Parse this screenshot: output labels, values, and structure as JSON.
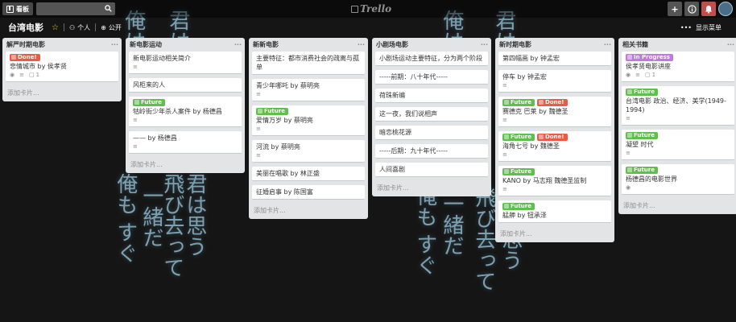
{
  "topbar": {
    "boards_label": "看板",
    "search_value": "",
    "logo_text": "Trello",
    "add_icon": "plus-icon",
    "info_icon": "info-icon",
    "notif_icon": "bell-icon"
  },
  "board": {
    "title": "台湾电影",
    "visibility_team": "个人",
    "visibility_public": "公开",
    "show_menu": "显示菜单"
  },
  "colors": {
    "red": "#eb5a46",
    "green": "#61bd4f",
    "purple": "#c377e0"
  },
  "lists": [
    {
      "name": "解严时期电影",
      "cards": [
        {
          "title": "悲情城市 by 侯孝贤",
          "labels": [
            {
              "text": "Done!",
              "color": "red"
            }
          ],
          "badges": {
            "watch": true,
            "desc": true,
            "checklist": "1"
          }
        }
      ],
      "add": "添加卡片..."
    },
    {
      "name": "新电影运动",
      "cards": [
        {
          "title": "新电影运动相关简介",
          "labels": [],
          "badges": {
            "desc": true
          }
        },
        {
          "title": "风柜来的人",
          "labels": [],
          "badges": {}
        },
        {
          "title": "牯岭街少年杀人案件 by 杨德昌",
          "labels": [
            {
              "text": "Future",
              "color": "green"
            }
          ],
          "badges": {
            "desc": true
          }
        },
        {
          "title": "—— by 杨德昌",
          "labels": [],
          "badges": {
            "desc": true
          }
        }
      ],
      "add": "添加卡片..."
    },
    {
      "name": "新新电影",
      "cards": [
        {
          "title": "主要特征：都市消费社会的疏离与孤单",
          "labels": [],
          "badges": {}
        },
        {
          "title": "青少年哪吒 by 蔡明亮",
          "labels": [],
          "badges": {
            "desc": true
          }
        },
        {
          "title": "爱情万岁 by 蔡明亮",
          "labels": [
            {
              "text": "Future",
              "color": "green"
            }
          ],
          "badges": {
            "desc": true
          }
        },
        {
          "title": "河流 by 蔡明亮",
          "labels": [],
          "badges": {
            "desc": true
          }
        },
        {
          "title": "美丽在唱歌 by 林正盛",
          "labels": [],
          "badges": {}
        },
        {
          "title": "征婚启事 by 陈国富",
          "labels": [],
          "badges": {}
        }
      ],
      "add": "添加卡片..."
    },
    {
      "name": "小剧场电影",
      "cards": [
        {
          "title": "小剧场运动主要特征，分为两个阶段",
          "labels": [],
          "badges": {}
        },
        {
          "title": "-----前期：八十年代-----",
          "labels": [],
          "badges": {}
        },
        {
          "title": "荷珠新编",
          "labels": [],
          "badges": {}
        },
        {
          "title": "这一夜，我们说相声",
          "labels": [],
          "badges": {}
        },
        {
          "title": "暗恋桃花源",
          "labels": [],
          "badges": {}
        },
        {
          "title": "-----后期：九十年代-----",
          "labels": [],
          "badges": {}
        },
        {
          "title": "人间喜剧",
          "labels": [],
          "badges": {}
        }
      ],
      "add": "添加卡片..."
    },
    {
      "name": "新时期电影",
      "cards": [
        {
          "title": "第四幅画 by 钟孟宏",
          "labels": [],
          "badges": {}
        },
        {
          "title": "停车 by 钟孟宏",
          "labels": [],
          "badges": {
            "desc": true
          }
        },
        {
          "title": "赛德克 巴莱 by 魏德圣",
          "labels": [
            {
              "text": "Future",
              "color": "green"
            },
            {
              "text": "Done!",
              "color": "red"
            }
          ],
          "badges": {
            "desc": true
          }
        },
        {
          "title": "海角七号 by 魏德圣",
          "labels": [
            {
              "text": "Future",
              "color": "green"
            },
            {
              "text": "Done!",
              "color": "red"
            }
          ],
          "badges": {
            "desc": true
          }
        },
        {
          "title": "KANO by 马志翔 魏德圣监制",
          "labels": [
            {
              "text": "Future",
              "color": "green"
            }
          ],
          "badges": {
            "desc": true
          }
        },
        {
          "title": "艋舺 by 钮承泽",
          "labels": [
            {
              "text": "Future",
              "color": "green"
            }
          ],
          "badges": {}
        }
      ],
      "add": "添加卡片..."
    },
    {
      "name": "相关书籍",
      "cards": [
        {
          "title": "侯孝贤电影讲座",
          "labels": [
            {
              "text": "In Progress",
              "color": "purple"
            }
          ],
          "badges": {
            "watch": true,
            "desc": true,
            "checklist": "1"
          }
        },
        {
          "title": "台湾电影 政治、经济、美学(1949-1994)",
          "labels": [
            {
              "text": "Future",
              "color": "green"
            }
          ],
          "badges": {
            "desc": true
          }
        },
        {
          "title": "凝望 时代",
          "labels": [
            {
              "text": "Future",
              "color": "green"
            }
          ],
          "badges": {
            "desc": true
          }
        },
        {
          "title": "杨德昌的电影世界",
          "labels": [
            {
              "text": "Future",
              "color": "green"
            }
          ],
          "badges": {
            "watch": true
          }
        }
      ],
      "add": "添加卡片..."
    }
  ]
}
